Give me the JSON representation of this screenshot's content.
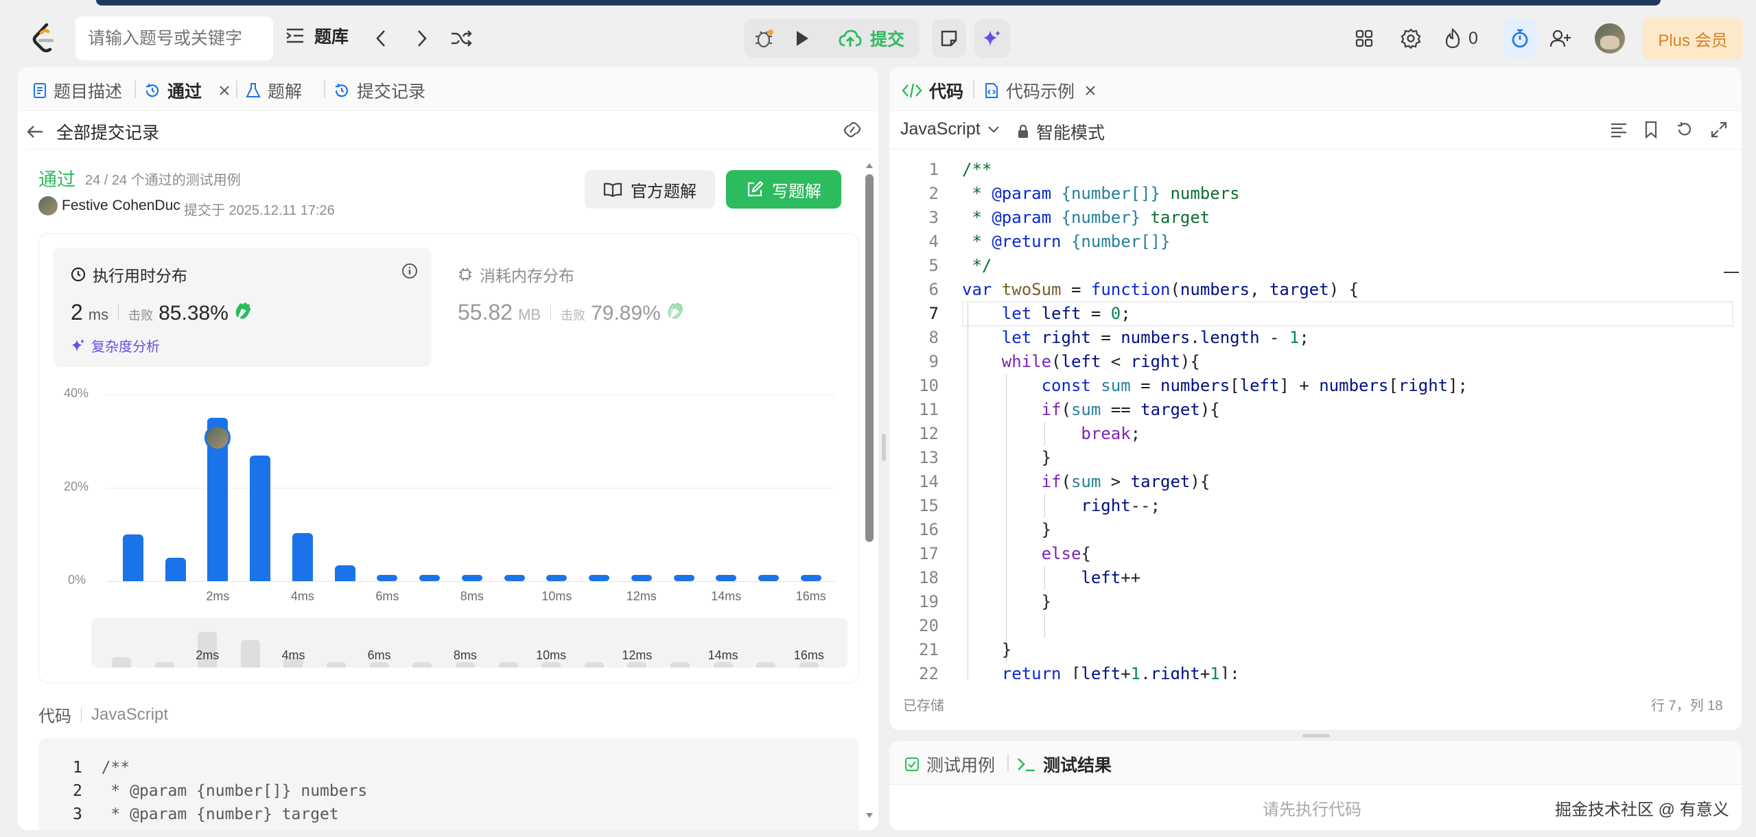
{
  "topbar": {
    "search_placeholder": "请输入题号或关键字",
    "problem_bank": "题库",
    "submit": "提交",
    "fire_count": "0",
    "plus_label": "Plus 会员"
  },
  "left_panel": {
    "tabs": [
      "题目描述",
      "通过",
      "题解",
      "提交记录"
    ],
    "back_label": "全部提交记录",
    "status": "通过",
    "testcases": "24 / 24 个通过的测试用例",
    "user": "Festive CohenDuc",
    "submitted_at": "提交于 2025.12.11 17:26",
    "official_solution": "官方题解",
    "write_solution": "写题解",
    "runtime": {
      "title": "执行用时分布",
      "value": "2",
      "unit": "ms",
      "beats_label": "击败",
      "beats": "85.38%",
      "complexity": "复杂度分析"
    },
    "memory": {
      "title": "消耗内存分布",
      "value": "55.82",
      "unit": "MB",
      "beats_label": "击败",
      "beats": "79.89%"
    },
    "code_label": "代码",
    "code_lang": "JavaScript",
    "code_preview": [
      {
        "n": "1",
        "text": "/**"
      },
      {
        "n": "2",
        "text": " * @param {number[]} numbers"
      },
      {
        "n": "3",
        "text": " * @param {number} target"
      }
    ]
  },
  "chart_data": {
    "type": "bar",
    "x": [
      1,
      2,
      3,
      4,
      5,
      6,
      7,
      8,
      9,
      10,
      11,
      12,
      13,
      14,
      15,
      16,
      17
    ],
    "x_unit": "ms",
    "values": [
      10.0,
      5.0,
      35.0,
      26.9,
      10.3,
      3.4,
      1.2,
      1.2,
      1.2,
      1.2,
      1.2,
      1.2,
      1.2,
      1.2,
      1.2,
      1.2,
      1.2
    ],
    "highlight_x": 3,
    "y_ticks": [
      "40%",
      "20%",
      "0%"
    ],
    "x_ticks": [
      "2ms",
      "4ms",
      "6ms",
      "8ms",
      "10ms",
      "12ms",
      "14ms",
      "16ms"
    ],
    "ylim": [
      0,
      40
    ],
    "y_unit": "%",
    "grid": true,
    "mini_ticks": [
      "2ms",
      "4ms",
      "6ms",
      "8ms",
      "10ms",
      "12ms",
      "14ms",
      "16ms"
    ]
  },
  "editor": {
    "tabs": [
      "代码",
      "代码示例"
    ],
    "language": "JavaScript",
    "mode": "智能模式",
    "saved": "已存储",
    "cursor": "行 7，列 18",
    "lines": [
      "/**",
      " * @param {number[]} numbers",
      " * @param {number} target",
      " * @return {number[]}",
      " */",
      "var twoSum = function(numbers, target) {",
      "    let left = 0;",
      "    let right = numbers.length - 1;",
      "    while(left < right){",
      "        const sum = numbers[left] + numbers[right];",
      "        if(sum == target){",
      "            break;",
      "        }",
      "        if(sum > target){",
      "            right--;",
      "        }",
      "        else{",
      "            left++",
      "        }",
      "",
      "    }",
      "    return [left+1,right+1];"
    ]
  },
  "bottom_panel": {
    "tabs": [
      "测试用例",
      "测试结果"
    ],
    "placeholder": "请先执行代码",
    "watermark": "掘金技术社区 @ 有意义"
  },
  "colors": {
    "accent_green": "#2cbb5d",
    "bar_blue": "#1a73e8",
    "plus_bg": "#fde8c9",
    "plus_text": "#d4822a"
  }
}
